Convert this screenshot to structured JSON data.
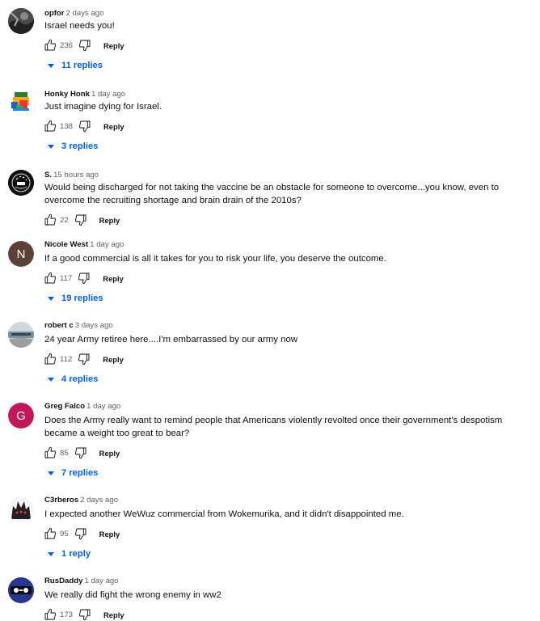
{
  "labels": {
    "reply": "Reply"
  },
  "comments": [
    {
      "author": "opfor",
      "time": "2 days ago",
      "text": "Israel needs you!",
      "likes": "236",
      "replies": "11 replies"
    },
    {
      "author": "Honky Honk",
      "time": "1 day ago",
      "text": "Just imagine dying for Israel.",
      "likes": "138",
      "replies": "3 replies"
    },
    {
      "author": "S.",
      "time": "15 hours ago",
      "text": "Would being discharged for not taking the vaccine be an obstacle for someone to overcome...you know, even to overcome the recruiting shortage and brain drain of the 2010s?",
      "likes": "22"
    },
    {
      "author": "Nicole West",
      "time": "1 day ago",
      "text": "If a good commercial is all it takes for you to risk your life, you deserve the outcome.",
      "likes": "117",
      "replies": "19 replies",
      "avatar_letter": "N",
      "avatar_color": "#5d4037"
    },
    {
      "author": "robert c",
      "time": "3 days ago",
      "text": "24 year Army retiree here....I'm embarrassed by our army now",
      "likes": "112",
      "replies": "4 replies"
    },
    {
      "author": "Greg Falco",
      "time": "1 day ago",
      "text": "Does the Army really want to remind people that Americans violently revolted once their government's despotism became a weight too great to bear?",
      "likes": "85",
      "replies": "7 replies",
      "avatar_letter": "G",
      "avatar_color": "#c2185b"
    },
    {
      "author": "C3rberos",
      "time": "2 days ago",
      "text": "I expected another WeWuz commercial from Wokemurika, and it didn't disappointed me.",
      "likes": "95",
      "replies": "1 reply"
    },
    {
      "author": "RusDaddy",
      "time": "1 day ago",
      "text": "We really did fight the wrong enemy in ww2",
      "likes": "173"
    }
  ],
  "colors": {
    "link_blue": "#065fd4",
    "meta_gray": "#606060"
  }
}
